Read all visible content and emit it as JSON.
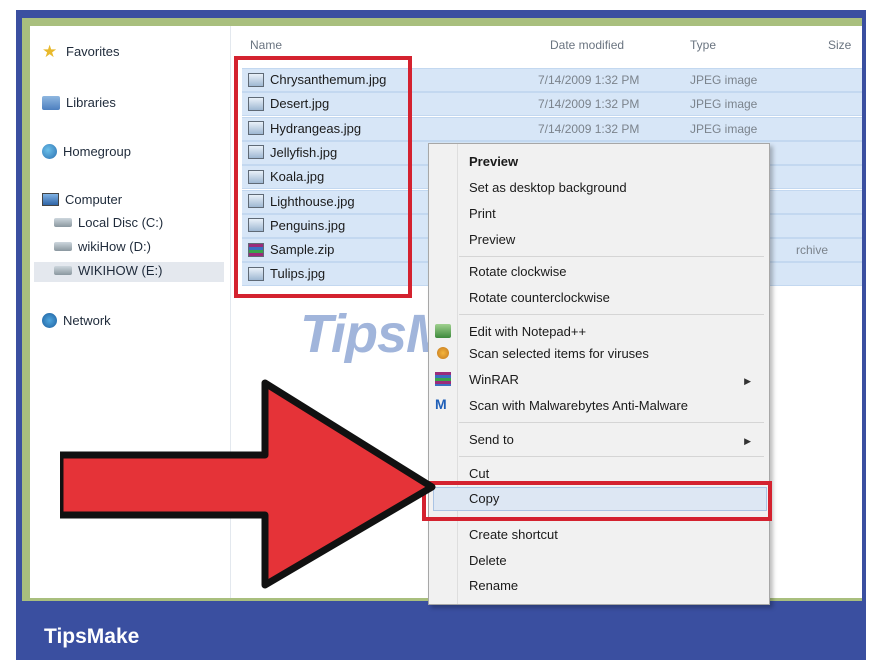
{
  "nav": {
    "favorites": "Favorites",
    "libraries": "Libraries",
    "homegroup": "Homegroup",
    "computer": "Computer",
    "local_disc": "Local Disc (C:)",
    "wikihow_d": "wikiHow (D:)",
    "wikihow_e": "WIKIHOW (E:)",
    "network": "Network"
  },
  "columns": {
    "name": "Name",
    "date": "Date modified",
    "type": "Type",
    "size": "Size"
  },
  "files": [
    {
      "name": "Chrysanthemum.jpg",
      "date": "7/14/2009 1:32 PM",
      "type": "JPEG image",
      "icon": "image-file-icon"
    },
    {
      "name": "Desert.jpg",
      "date": "7/14/2009 1:32 PM",
      "type": "JPEG image",
      "icon": "image-file-icon"
    },
    {
      "name": "Hydrangeas.jpg",
      "date": "7/14/2009 1:32 PM",
      "type": "JPEG image",
      "icon": "image-file-icon"
    },
    {
      "name": "Jellyfish.jpg",
      "date": "",
      "type": "",
      "icon": "image-file-icon"
    },
    {
      "name": "Koala.jpg",
      "date": "",
      "type": "",
      "icon": "image-file-icon"
    },
    {
      "name": "Lighthouse.jpg",
      "date": "",
      "type": "",
      "icon": "image-file-icon"
    },
    {
      "name": "Penguins.jpg",
      "date": "",
      "type": "",
      "icon": "image-file-icon"
    },
    {
      "name": "Sample.zip",
      "date": "",
      "type": "rchive",
      "icon": "zip-archive-icon"
    },
    {
      "name": "Tulips.jpg",
      "date": "",
      "type": "",
      "icon": "image-file-icon"
    }
  ],
  "context_menu": {
    "preview_bold": "Preview",
    "set_desktop": "Set as desktop background",
    "print": "Print",
    "preview": "Preview",
    "rotate_cw": "Rotate clockwise",
    "rotate_ccw": "Rotate counterclockwise",
    "edit_notepad": "Edit with Notepad++",
    "scan_viruses": "Scan selected items for viruses",
    "winrar": "WinRAR",
    "malwarebytes": "Scan with Malwarebytes Anti-Malware",
    "send_to": "Send to",
    "cut": "Cut",
    "copy": "Copy",
    "create_shortcut": "Create shortcut",
    "delete": "Delete",
    "rename": "Rename"
  },
  "watermark": "TipsMake",
  "brand": "TipsMake",
  "colors": {
    "highlight": "#d4222f",
    "frame": "#3a4fa0",
    "selection": "#d7e6f7"
  }
}
